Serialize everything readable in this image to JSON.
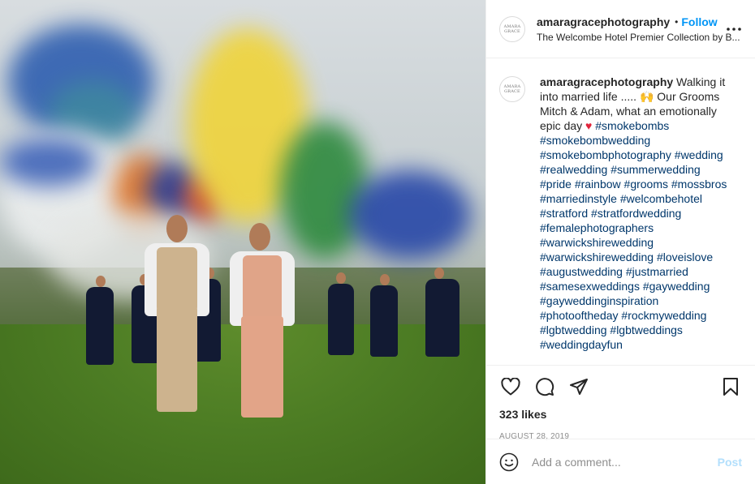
{
  "header": {
    "username": "amaragracephotography",
    "separator": "•",
    "follow_label": "Follow",
    "location": "The Welcombe Hotel Premier Collection by B...",
    "more_icon": "more-horizontal-icon",
    "avatar_label": "AMARA GRACE"
  },
  "caption": {
    "username": "amaragracephotography",
    "text_1": " Walking it into married life ..... ",
    "emoji_1": "🙌",
    "text_2": " Our Grooms Mitch & Adam, what an emotionally epic day ",
    "emoji_2": "♥",
    "hashtags": [
      "#smokebombs",
      "#smokebombwedding",
      "#smokebombphotography",
      "#wedding",
      "#realwedding",
      "#summerwedding",
      "#pride",
      "#rainbow",
      "#grooms",
      "#mossbros",
      "#marriedinstyle",
      "#welcombehotel",
      "#stratford",
      "#stratfordwedding",
      "#femalephotographers",
      "#warwickshirewedding",
      "#warwickshirewedding",
      "#loveislove",
      "#augustwedding",
      "#justmarried",
      "#samesexweddings",
      "#gaywedding",
      "#gayweddinginspiration",
      "#photooftheday",
      "#rockmywedding",
      "#lgbtwedding",
      "#lgbtweddings",
      "#weddingdayfun"
    ]
  },
  "actions": {
    "like_icon": "heart-outline-icon",
    "comment_icon": "comment-bubble-icon",
    "share_icon": "paper-plane-icon",
    "save_icon": "bookmark-icon",
    "likes": "323 likes",
    "date": "AUGUST 28, 2019"
  },
  "comment": {
    "emoji_icon": "smiley-icon",
    "placeholder": "Add a comment...",
    "post_label": "Post"
  },
  "colors": {
    "accent_blue": "#0095f6",
    "hashtag": "#00376b",
    "muted": "#8e8e8e",
    "post_disabled": "#b2dffc"
  }
}
